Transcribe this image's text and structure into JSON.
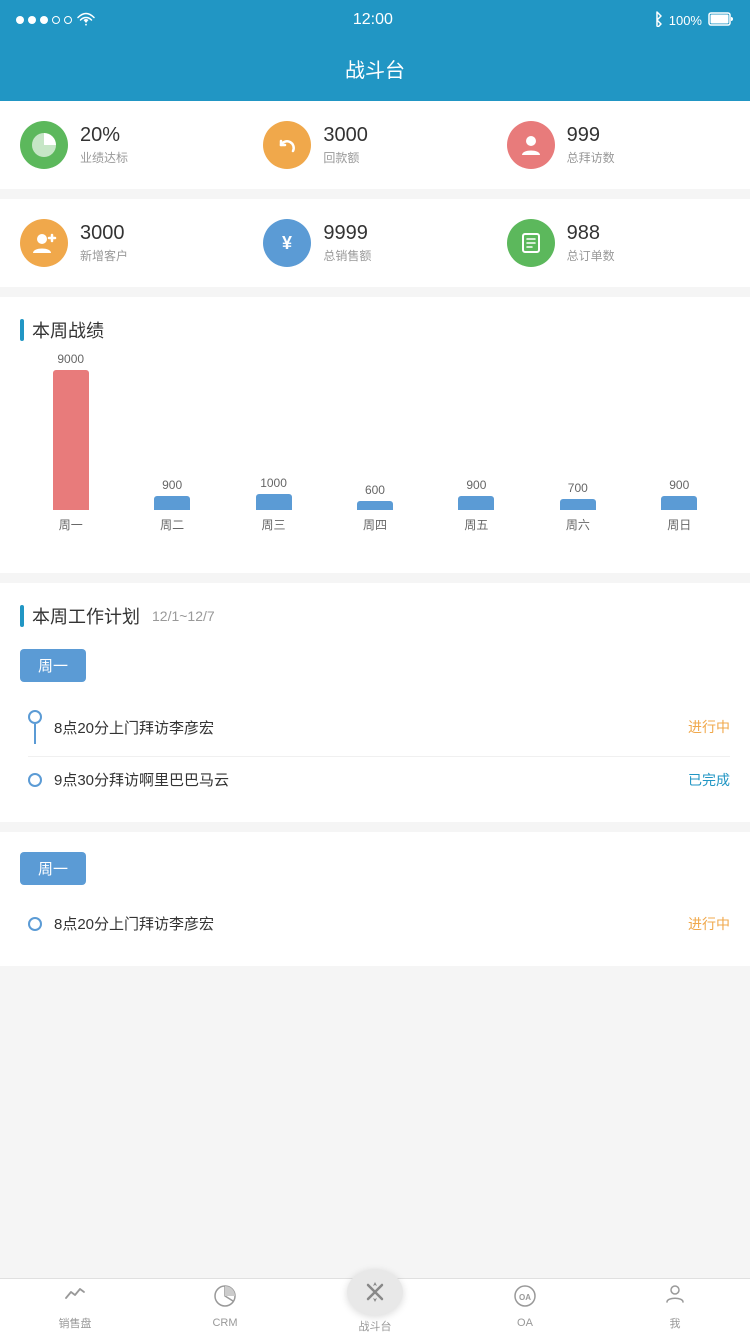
{
  "statusBar": {
    "time": "12:00",
    "battery": "100%"
  },
  "header": {
    "title": "战斗台"
  },
  "stats1": [
    {
      "icon": "pie-icon",
      "iconClass": "icon-green",
      "value": "20%",
      "label": "业绩达标"
    },
    {
      "icon": "refresh-icon",
      "iconClass": "icon-orange",
      "value": "3000",
      "label": "回款额"
    },
    {
      "icon": "person-icon",
      "iconClass": "icon-pink",
      "value": "999",
      "label": "总拜访数"
    }
  ],
  "stats2": [
    {
      "icon": "add-person-icon",
      "iconClass": "icon-orange2",
      "value": "3000",
      "label": "新增客户"
    },
    {
      "icon": "yen-icon",
      "iconClass": "icon-blue",
      "value": "9999",
      "label": "总销售额"
    },
    {
      "icon": "list-icon",
      "iconClass": "icon-green2",
      "value": "988",
      "label": "总订单数"
    }
  ],
  "chart": {
    "title": "本周战绩",
    "bars": [
      {
        "label": "周一",
        "value": 9000,
        "color": "#e87b7b"
      },
      {
        "label": "周二",
        "value": 900,
        "color": "#5b9bd5"
      },
      {
        "label": "周三",
        "value": 1000,
        "color": "#5b9bd5"
      },
      {
        "label": "周四",
        "value": 600,
        "color": "#5b9bd5"
      },
      {
        "label": "周五",
        "value": 900,
        "color": "#5b9bd5"
      },
      {
        "label": "周六",
        "value": 700,
        "color": "#5b9bd5"
      },
      {
        "label": "周日",
        "value": 900,
        "color": "#5b9bd5"
      }
    ],
    "maxValue": 9000
  },
  "plan": {
    "title": "本周工作计划",
    "dateRange": "12/1~12/7",
    "sections": [
      {
        "day": "周一",
        "items": [
          {
            "text": "8点20分上门拜访李彦宏",
            "status": "进行中",
            "statusClass": "plan-status-in-progress"
          },
          {
            "text": "9点30分拜访啊里巴巴马云",
            "status": "已完成",
            "statusClass": "plan-status-done"
          }
        ]
      },
      {
        "day": "周一",
        "items": [
          {
            "text": "8点20分上门拜访李彦宏",
            "status": "进行中",
            "statusClass": "plan-status-in-progress"
          }
        ]
      }
    ]
  },
  "bottomNav": [
    {
      "id": "sales",
      "icon": "📈",
      "label": "销售盘",
      "active": false
    },
    {
      "id": "crm",
      "icon": "🥧",
      "label": "CRM",
      "active": false
    },
    {
      "id": "battle",
      "icon": "⚔️",
      "label": "战斗台",
      "active": true
    },
    {
      "id": "oa",
      "icon": "🔵",
      "label": "OA",
      "active": false
    },
    {
      "id": "me",
      "icon": "👤",
      "label": "我",
      "active": false
    }
  ]
}
